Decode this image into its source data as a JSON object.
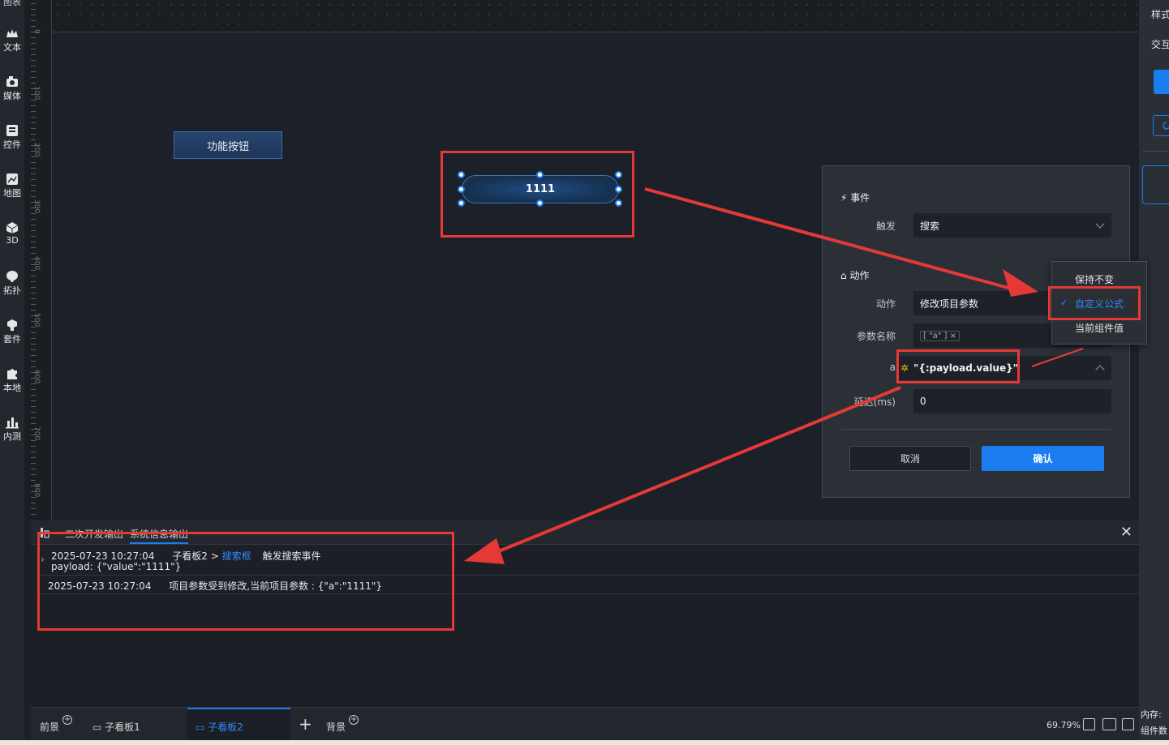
{
  "sidebar": {
    "top_label": "图表",
    "items": [
      {
        "label": "文本",
        "icon": "text-icon"
      },
      {
        "label": "媒体",
        "icon": "media-icon"
      },
      {
        "label": "控件",
        "icon": "widget-icon"
      },
      {
        "label": "地图",
        "icon": "map-icon"
      },
      {
        "label": "3D",
        "icon": "cube-icon"
      },
      {
        "label": "拓扑",
        "icon": "topology-icon"
      },
      {
        "label": "套件",
        "icon": "kit-icon"
      },
      {
        "label": "本地",
        "icon": "puzzle-icon"
      },
      {
        "label": "内测",
        "icon": "bar-chart-icon"
      }
    ]
  },
  "ruler": {
    "labels": [
      "0",
      "100",
      "200",
      "300",
      "400",
      "500",
      "600",
      "700",
      "800"
    ]
  },
  "right_panel": {
    "tab_style": "样式",
    "tab_interact": "交互"
  },
  "canvas": {
    "func_button_label": "功能按钮",
    "selected_button_label": "1111"
  },
  "dialog": {
    "event_section": "事件",
    "trigger_label": "触发",
    "trigger_value": "搜索",
    "action_section": "动作",
    "action_label": "动作",
    "action_value": "修改项目参数",
    "param_name_label": "参数名称",
    "param_tag": "[ \"a\" ] ×",
    "param_a_label": "a",
    "param_a_value": "\"{:payload.value}\"",
    "delay_label": "延迟(ms)",
    "delay_value": "0",
    "cancel": "取消",
    "confirm": "确认"
  },
  "menu": {
    "items": [
      "保持不变",
      "自定义公式",
      "当前组件值"
    ],
    "selected": "自定义公式"
  },
  "console": {
    "tab_dev": "二次开发输出",
    "tab_sys": "系统信息输出",
    "log1_time": "2025-07-23 10:27:04",
    "log1_path": "子看板2 >",
    "log1_link": "搜索框",
    "log1_event": "触发搜索事件",
    "log1_payload": "payload: {\"value\":\"1111\"}",
    "log2_time": "2025-07-23 10:27:04",
    "log2_msg": "项目参数受到修改,当前项目参数 : {\"a\":\"1111\"}"
  },
  "tabs": {
    "foreground": "前景",
    "sub1": "子看板1",
    "sub2": "子看板2",
    "background": "背景",
    "zoom": "69.79%",
    "memory": "内存:",
    "component_count": "组件数"
  },
  "colors": {
    "accent": "#1a7ef0",
    "highlight_red": "#e53935",
    "canvas_bg": "#1b2029"
  }
}
